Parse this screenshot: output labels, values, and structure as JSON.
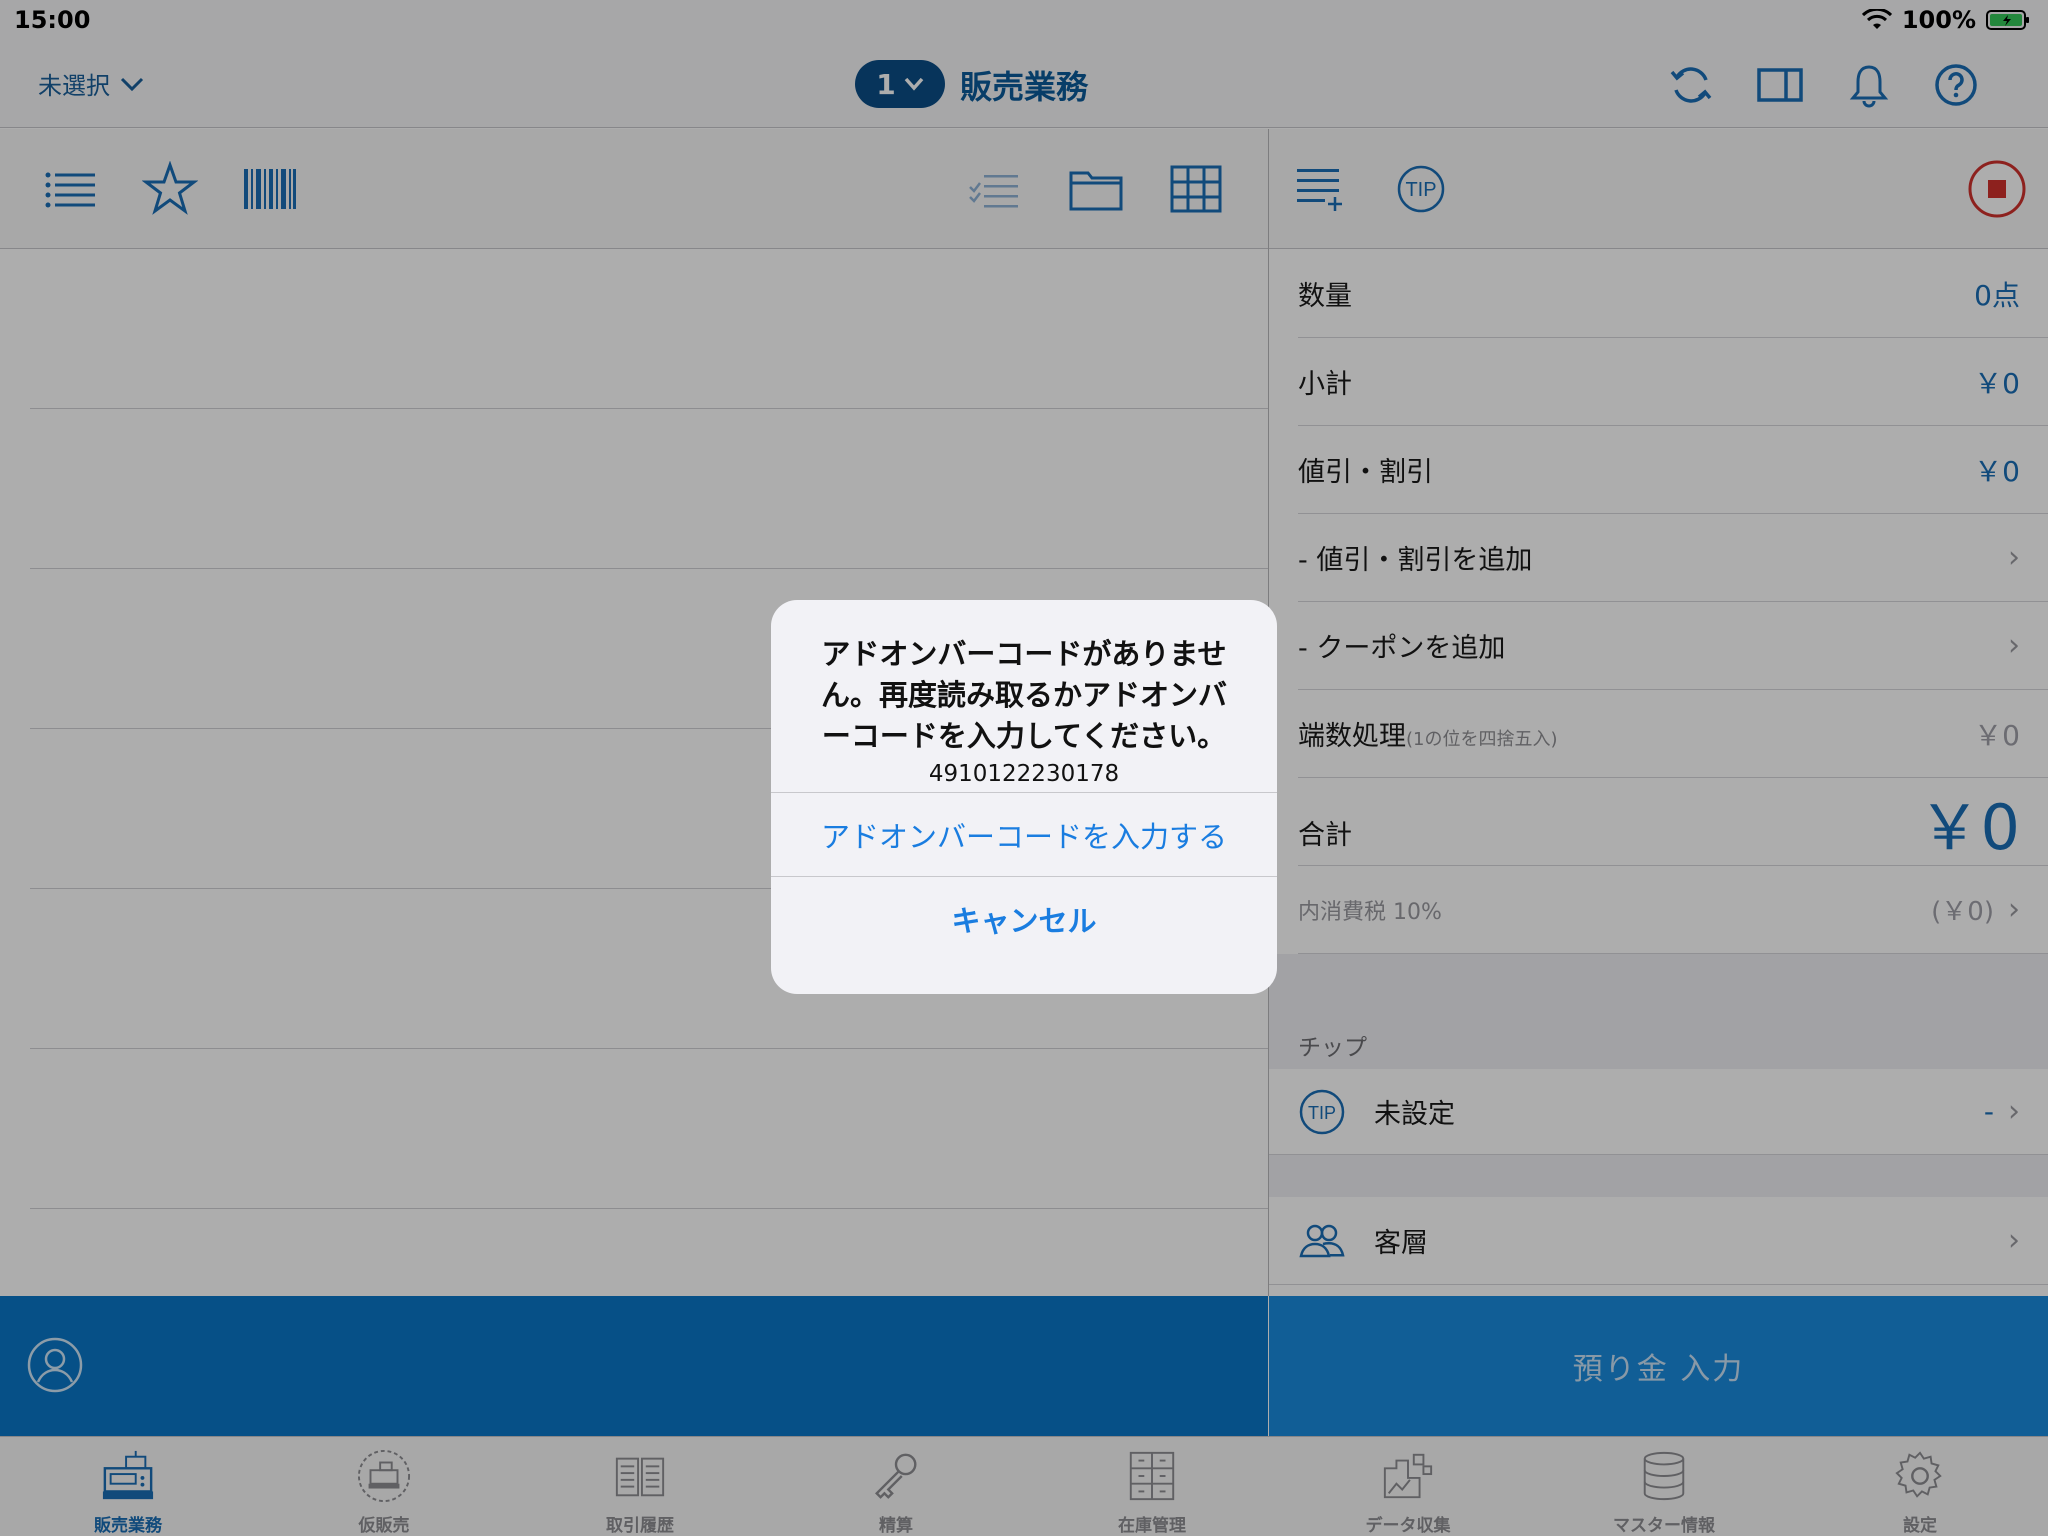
{
  "status_bar": {
    "time": "15:00",
    "battery": "100%"
  },
  "nav": {
    "store_select": "未選択",
    "register_number": "1",
    "title": "販売業務"
  },
  "summary": {
    "quantity": {
      "label": "数量",
      "value": "0点"
    },
    "subtotal": {
      "label": "小計",
      "value": "￥0"
    },
    "discount": {
      "label": "値引・割引",
      "value": "￥0"
    },
    "add_discount": {
      "label": "- 値引・割引を追加"
    },
    "add_coupon": {
      "label": "- クーポンを追加"
    },
    "rounding": {
      "label": "端数処理",
      "note": "(1の位を四捨五入)",
      "value": "￥0"
    },
    "total": {
      "label": "合計",
      "value": "￥0"
    },
    "tax": {
      "label": "内消費税 10%",
      "value": "(￥0)"
    }
  },
  "tip_section": {
    "header": "チップ",
    "label": "未設定",
    "value": "-",
    "icon_text": "TIP"
  },
  "customer_segment": {
    "label": "客層"
  },
  "deposit_button": {
    "label": "預り金 入力"
  },
  "tabs": [
    {
      "label": "販売業務",
      "icon": "register-icon",
      "active": true
    },
    {
      "label": "仮販売",
      "icon": "temp-sale-icon",
      "active": false
    },
    {
      "label": "取引履歴",
      "icon": "history-book-icon",
      "active": false
    },
    {
      "label": "精算",
      "icon": "key-icon",
      "active": false
    },
    {
      "label": "在庫管理",
      "icon": "inventory-icon",
      "active": false
    },
    {
      "label": "データ収集",
      "icon": "data-collect-icon",
      "active": false
    },
    {
      "label": "マスター情報",
      "icon": "database-icon",
      "active": false
    },
    {
      "label": "設定",
      "icon": "gear-icon",
      "active": false
    }
  ],
  "alert": {
    "message": "アドオンバーコードがありません。再度読み取るかアドオンバーコードを入力してください。",
    "code": "4910122230178",
    "primary_button": "アドオンバーコードを入力する",
    "cancel_button": "キャンセル"
  },
  "colors": {
    "accent": "#1a6eb5",
    "nav_badge": "#0b4d86",
    "bottom_bar_left": "#0a77c7",
    "bottom_bar_right": "#1a8bdd",
    "stop_red": "#d0312d",
    "alert_link": "#1a7de0"
  }
}
